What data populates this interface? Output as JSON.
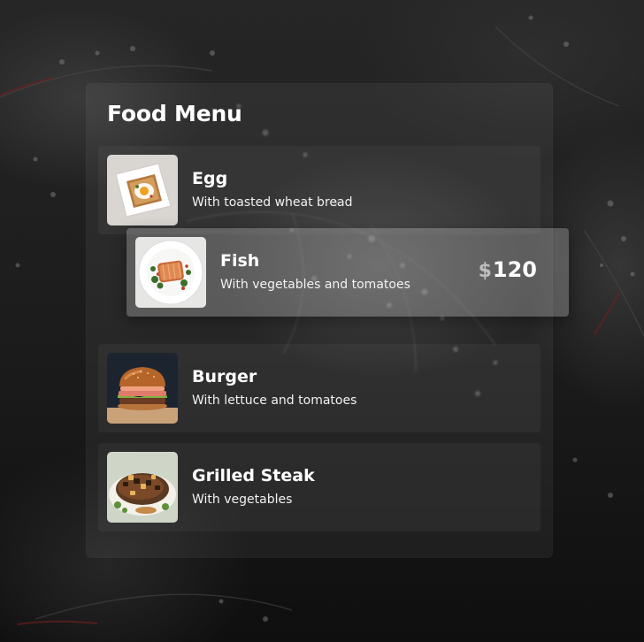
{
  "menu": {
    "title": "Food Menu",
    "items": [
      {
        "name": "Egg",
        "description": "With toasted wheat bread",
        "image": "egg-on-toast-photo",
        "highlighted": false
      },
      {
        "name": "Fish",
        "description": "With vegetables and tomatoes",
        "image": "salmon-plate-photo",
        "highlighted": true,
        "currency": "$",
        "price": "120"
      },
      {
        "name": "Burger",
        "description": "With lettuce and tomatoes",
        "image": "burger-photo",
        "highlighted": false
      },
      {
        "name": "Grilled Steak",
        "description": "With vegetables",
        "image": "grilled-steak-photo",
        "highlighted": false
      }
    ]
  },
  "colors": {
    "text": "#ffffff",
    "currency": "#bdbdbd",
    "background": "#141414"
  }
}
